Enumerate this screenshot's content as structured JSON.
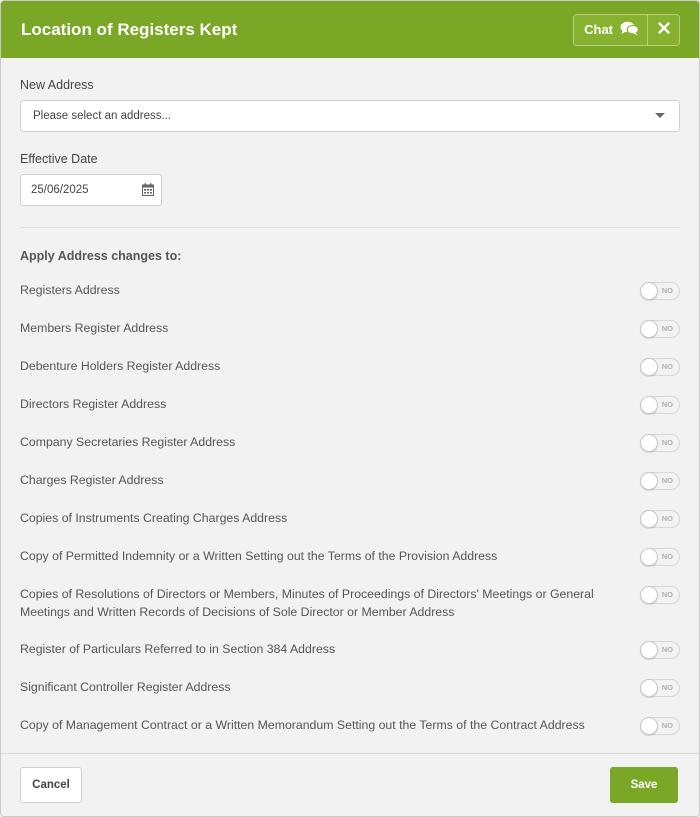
{
  "header": {
    "title": "Location of Registers Kept",
    "chat_label": "Chat",
    "chat_icon": "comments-icon",
    "close_icon": "close-icon",
    "accent_color": "#7aa726"
  },
  "form": {
    "new_address_label": "New Address",
    "address_placeholder": "Please select an address...",
    "effective_date_label": "Effective Date",
    "effective_date_value": "25/06/2025",
    "apply_title": "Apply Address changes to:"
  },
  "toggles": [
    {
      "label": "Registers Address",
      "state": "NO"
    },
    {
      "label": "Members Register Address",
      "state": "NO"
    },
    {
      "label": "Debenture Holders Register Address",
      "state": "NO"
    },
    {
      "label": "Directors Register Address",
      "state": "NO"
    },
    {
      "label": "Company Secretaries Register Address",
      "state": "NO"
    },
    {
      "label": "Charges Register Address",
      "state": "NO"
    },
    {
      "label": "Copies of Instruments Creating Charges Address",
      "state": "NO"
    },
    {
      "label": "Copy of Permitted Indemnity or a Written Setting out the Terms of the Provision Address",
      "state": "NO"
    },
    {
      "label": "Copies of Resolutions of Directors or Members, Minutes of Proceedings of Directors' Meetings or General Meetings and Written Records of Decisions of Sole Director or Member Address",
      "state": "NO"
    },
    {
      "label": "Register of Particulars Referred to in Section 384 Address",
      "state": "NO"
    },
    {
      "label": "Significant Controller Register Address",
      "state": "NO"
    },
    {
      "label": "Copy of Management Contract or a Written Memorandum Setting out the Terms of the Contract Address",
      "state": "NO"
    }
  ],
  "footer": {
    "cancel_label": "Cancel",
    "save_label": "Save"
  }
}
